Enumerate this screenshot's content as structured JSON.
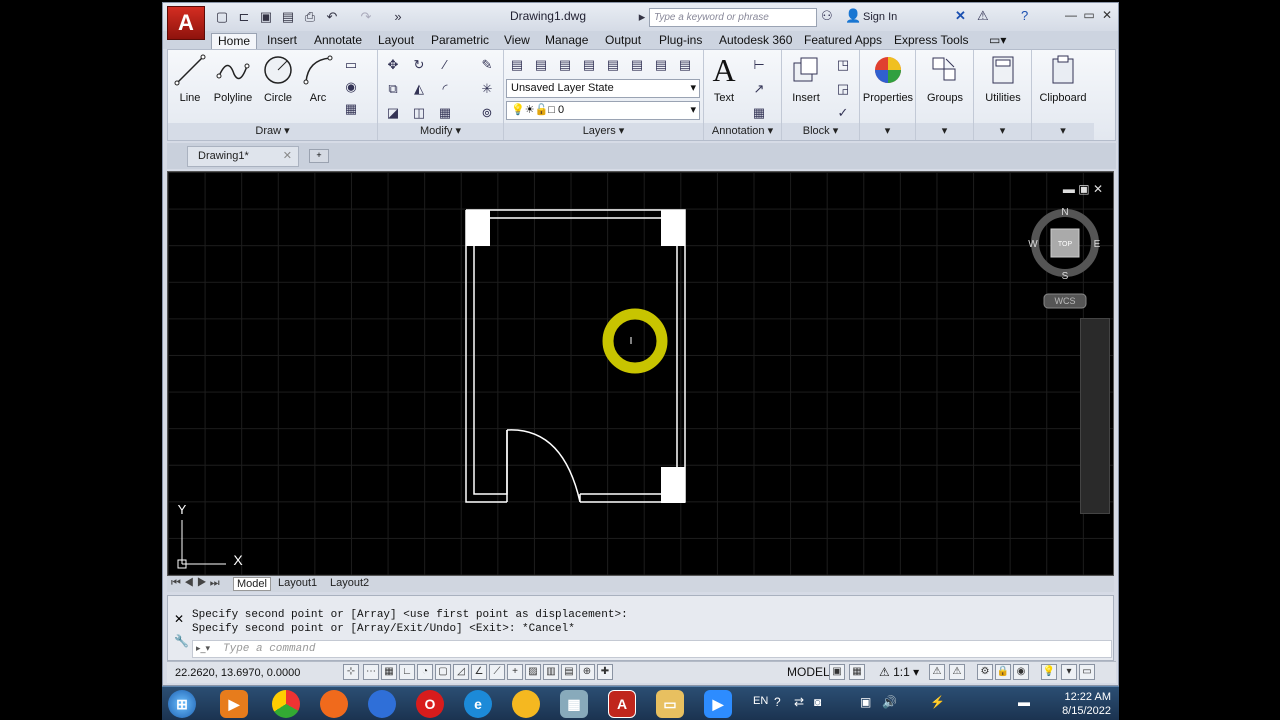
{
  "title_bar": {
    "document_title": "Drawing1.dwg",
    "search_placeholder": "Type a keyword or phrase",
    "sign_in": "Sign In",
    "app_icon": "autocad-logo-icon"
  },
  "tabs": [
    "Home",
    "Insert",
    "Annotate",
    "Layout",
    "Parametric",
    "View",
    "Manage",
    "Output",
    "Plug-ins",
    "Autodesk 360",
    "Featured Apps",
    "Express Tools"
  ],
  "active_tab": "Home",
  "ribbon": {
    "draw": {
      "label": "Draw",
      "tools": [
        "Line",
        "Polyline",
        "Circle",
        "Arc"
      ]
    },
    "modify": {
      "label": "Modify"
    },
    "layers": {
      "label": "Layers",
      "layer_state": "Unsaved Layer State",
      "current_layer": "0"
    },
    "annotation": {
      "label": "Annotation",
      "text_tool": "Text"
    },
    "block": {
      "label": "Block",
      "insert_tool": "Insert"
    },
    "properties": "Properties",
    "groups": "Groups",
    "utilities": "Utilities",
    "clipboard": "Clipboard"
  },
  "file_tab": {
    "name": "Drawing1*"
  },
  "viewcube": {
    "north": "N",
    "south": "S",
    "east": "E",
    "west": "W",
    "face": "TOP",
    "ucs": "WCS"
  },
  "ucs_icon": {
    "y": "Y",
    "x": "X"
  },
  "layout_tabs": [
    "Model",
    "Layout1",
    "Layout2"
  ],
  "active_layout": "Model",
  "command": {
    "history": [
      "Specify second point or [Array] <use first point as displacement>:",
      "Specify second point or [Array/Exit/Undo] <Exit>: *Cancel*"
    ],
    "placeholder": "Type a command"
  },
  "status": {
    "coordinates": "22.2620, 13.6970, 0.0000",
    "model_button": "MODEL",
    "annotation_scale": "1:1"
  },
  "taskbar": {
    "time": "12:22 AM",
    "date": "8/15/2022",
    "language": "EN"
  },
  "colors": {
    "drawing_lines": "#ffffff",
    "cursor_ring": "#c8c400",
    "canvas_bg": "#000000",
    "app_red": "#c0261c"
  }
}
